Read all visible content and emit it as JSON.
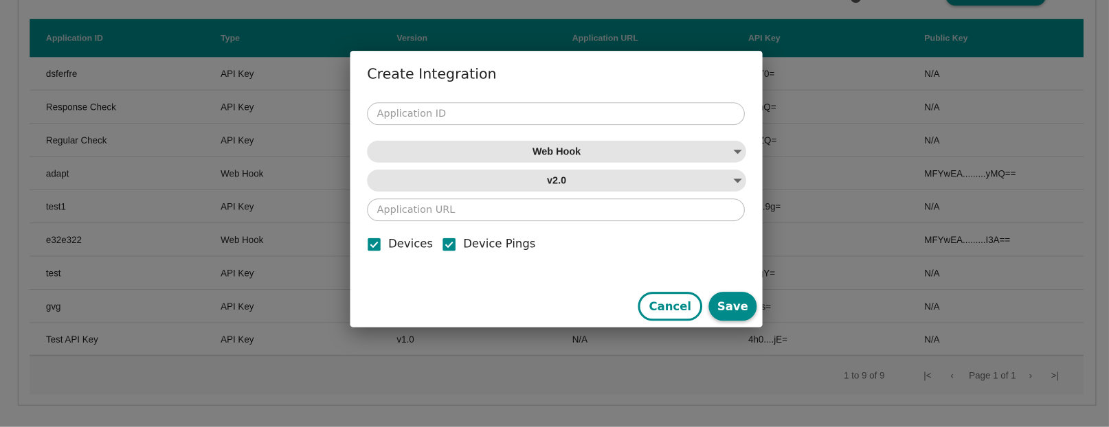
{
  "table": {
    "columns": [
      "Application ID",
      "Type",
      "Version",
      "Application URL",
      "API Key",
      "Public Key"
    ],
    "rows": [
      [
        "dsferfre",
        "API Key",
        "",
        "",
        "....T0=",
        "N/A"
      ],
      [
        "Response Check",
        "API Key",
        "",
        "",
        "....hQ=",
        "N/A"
      ],
      [
        "Regular Check",
        "API Key",
        "",
        "",
        "....ZQ=",
        "N/A"
      ],
      [
        "adapt",
        "Web Hook",
        "",
        "",
        "",
        "MFYwEA.........yMQ=="
      ],
      [
        "test1",
        "API Key",
        "",
        "",
        "C....9g=",
        "N/A"
      ],
      [
        "e32e322",
        "Web Hook",
        "",
        "",
        "",
        "MFYwEA.........I3A=="
      ],
      [
        "test",
        "API Key",
        "",
        "",
        "....gY=",
        "N/A"
      ],
      [
        "gvg",
        "API Key",
        "",
        "",
        "....Is=",
        "N/A"
      ],
      [
        "Test API Key",
        "API Key",
        "v1.0",
        "N/A",
        "4h0....jE=",
        "N/A"
      ]
    ]
  },
  "pagination": {
    "summary": "1 to 9 of 9",
    "page": "Page 1 of 1",
    "first_icon": "first-page-icon",
    "prev_icon": "chevron-left-icon",
    "next_icon": "chevron-right-icon",
    "last_icon": "last-page-icon"
  },
  "dialog": {
    "title": "Create Integration",
    "app_id_placeholder": "Application ID",
    "type_value": "Web Hook",
    "version_value": "v2.0",
    "app_url_placeholder": "Application URL",
    "checkboxes": [
      {
        "label": "Devices",
        "checked": true
      },
      {
        "label": "Device Pings",
        "checked": true
      }
    ],
    "cancel": "Cancel",
    "save": "Save"
  },
  "colors": {
    "accent": "#008a8a"
  }
}
